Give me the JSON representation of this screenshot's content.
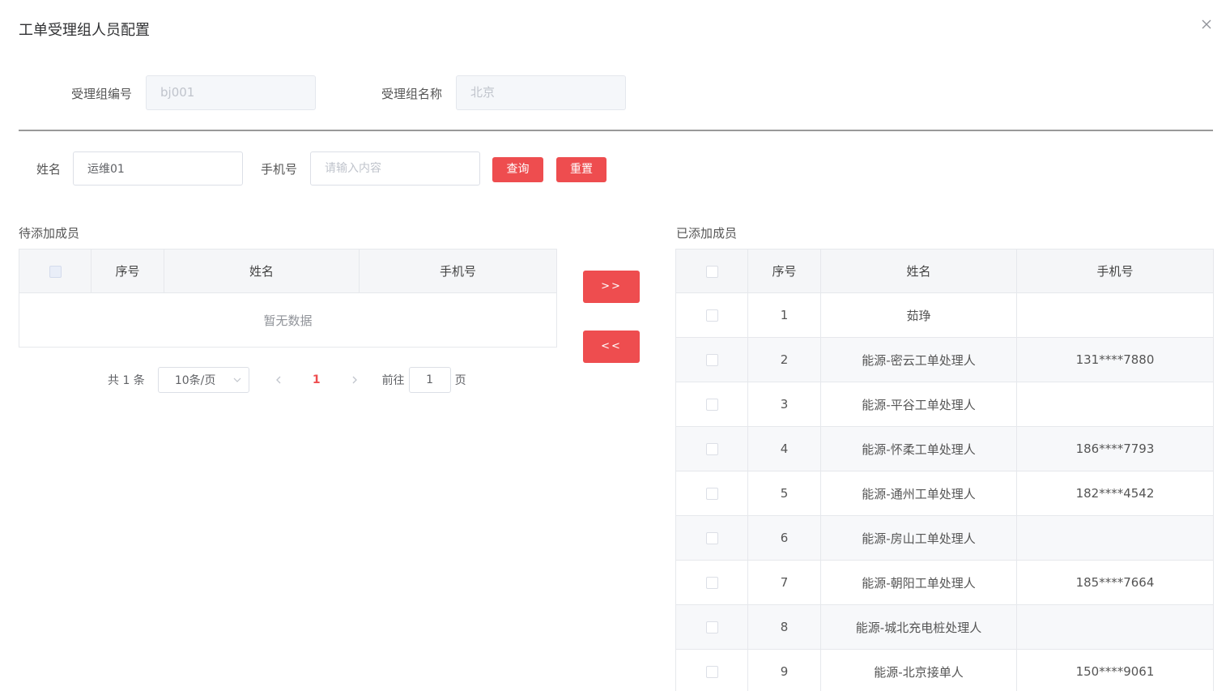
{
  "dialog": {
    "title": "工单受理组人员配置"
  },
  "group": {
    "code_label": "受理组编号",
    "code_value": "bj001",
    "name_label": "受理组名称",
    "name_value": "北京"
  },
  "search": {
    "name_label": "姓名",
    "name_value": "运维01",
    "phone_label": "手机号",
    "phone_placeholder": "请输入内容",
    "query_label": "查询",
    "reset_label": "重置"
  },
  "pending": {
    "title": "待添加成员",
    "headers": [
      "序号",
      "姓名",
      "手机号"
    ],
    "empty_text": "暂无数据"
  },
  "pagination": {
    "total_text": "共 1 条",
    "page_size": "10条/页",
    "current_page": "1",
    "goto_label": "前往",
    "goto_value": "1",
    "page_suffix": "页"
  },
  "transfer": {
    "add_label": ">>",
    "remove_label": "<<"
  },
  "added": {
    "title": "已添加成员",
    "headers": [
      "序号",
      "姓名",
      "手机号"
    ],
    "rows": [
      {
        "index": "1",
        "name": "茹琤",
        "phone": ""
      },
      {
        "index": "2",
        "name": "能源-密云工单处理人",
        "phone": "131****7880"
      },
      {
        "index": "3",
        "name": "能源-平谷工单处理人",
        "phone": ""
      },
      {
        "index": "4",
        "name": "能源-怀柔工单处理人",
        "phone": "186****7793"
      },
      {
        "index": "5",
        "name": "能源-通州工单处理人",
        "phone": "182****4542"
      },
      {
        "index": "6",
        "name": "能源-房山工单处理人",
        "phone": ""
      },
      {
        "index": "7",
        "name": "能源-朝阳工单处理人",
        "phone": "185****7664"
      },
      {
        "index": "8",
        "name": "能源-城北充电桩处理人",
        "phone": ""
      },
      {
        "index": "9",
        "name": "能源-北京接单人",
        "phone": "150****9061"
      }
    ]
  },
  "colors": {
    "accent": "#ee4d4f"
  },
  "icons": {
    "close": "close-icon",
    "prev": "chevron-left-icon",
    "next": "chevron-right-icon",
    "select": "chevron-down-icon"
  }
}
